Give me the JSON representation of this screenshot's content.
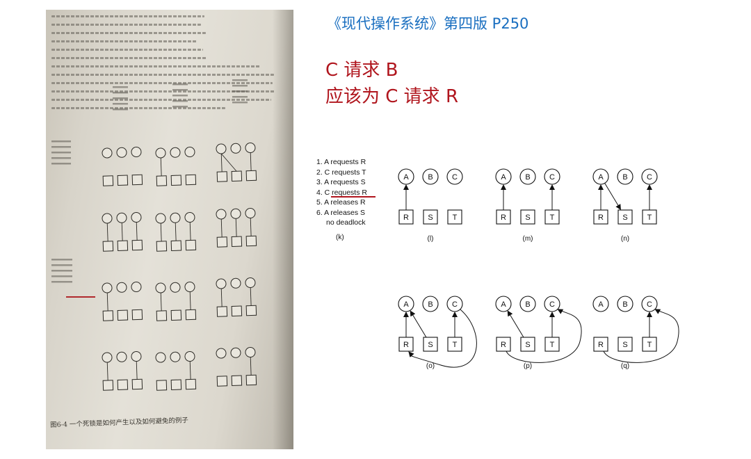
{
  "header": {
    "book_reference": "《现代操作系统》第四版 P250",
    "note_line1": "C 请求 B",
    "note_line2": "应该为 C 请求 R"
  },
  "colors": {
    "reference_blue": "#1a6fc0",
    "note_red": "#b0151d"
  },
  "photo": {
    "figure_caption": "图6-4 一个死锁是如何产生以及如何避免的例子",
    "lettering_note": "Photo of a printed book page; its small Chinese text is reproduced only as a picture."
  },
  "sequence": {
    "steps": [
      "1. A requests R",
      "2. C requests T",
      "3. A requests S",
      "4. C requests R",
      "5. A releases R",
      "6. A releases S"
    ],
    "result": "no deadlock",
    "label": "(k)"
  },
  "processes": [
    "A",
    "B",
    "C"
  ],
  "resources": [
    "R",
    "S",
    "T"
  ],
  "panels": [
    {
      "label": "(l)",
      "edges": [
        [
          "R",
          "A"
        ]
      ]
    },
    {
      "label": "(m)",
      "edges": [
        [
          "R",
          "A"
        ],
        [
          "T",
          "C"
        ]
      ]
    },
    {
      "label": "(n)",
      "edges": [
        [
          "R",
          "A"
        ],
        [
          "T",
          "C"
        ],
        [
          "A",
          "S"
        ]
      ]
    },
    {
      "label": "(o)",
      "edges": [
        [
          "R",
          "A"
        ],
        [
          "T",
          "C"
        ],
        [
          "S",
          "A"
        ],
        [
          "C",
          "R"
        ]
      ]
    },
    {
      "label": "(p)",
      "edges": [
        [
          "T",
          "C"
        ],
        [
          "S",
          "A"
        ],
        [
          "R",
          "C"
        ]
      ]
    },
    {
      "label": "(q)",
      "edges": [
        [
          "T",
          "C"
        ],
        [
          "R",
          "C"
        ]
      ]
    }
  ]
}
